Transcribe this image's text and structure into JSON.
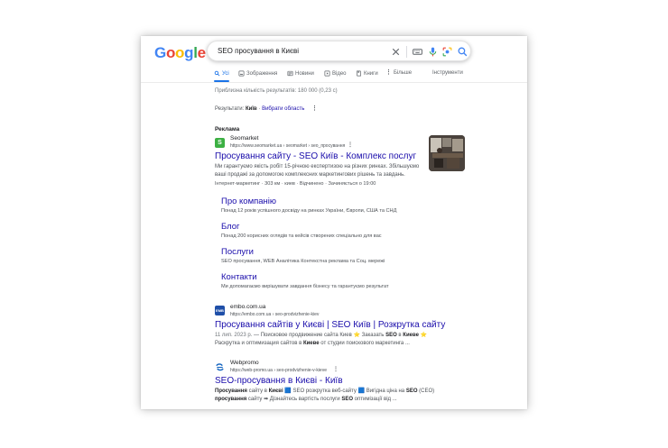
{
  "search": {
    "query": "SEO просування в Києві"
  },
  "tabs": [
    {
      "label": "Усі",
      "icon": "search-icon",
      "active": true
    },
    {
      "label": "Зображення",
      "icon": "image-icon"
    },
    {
      "label": "Новини",
      "icon": "news-icon"
    },
    {
      "label": "Відео",
      "icon": "video-icon"
    },
    {
      "label": "Книги",
      "icon": "book-icon"
    },
    {
      "label": "Більше",
      "icon": "more-vert-icon"
    },
    {
      "label": "Інструменти",
      "icon": ""
    }
  ],
  "stats": "Приблизна кількість результатів: 180 000 (0,23 с)",
  "location": {
    "prefix": "Результати:",
    "city": "Київ",
    "sep": " · ",
    "choose": "Вибрати область"
  },
  "ad": {
    "label": "Реклама",
    "site": "Seomarket",
    "url": "https://www.seomarket.ua › seomarket › seo_просування",
    "title": "Просування сайту - SEO Київ - Комплекс послуг",
    "snippet1": "Ми гарантуємо якість робіт 15-річною експертизою на різних ринках. Збільшуємо",
    "snippet2": "ваші продажі за допомогою комплексних маркетингових рішень та завдань.",
    "meta": "Інтернет-маркетинг · 303 км · киев · Відчинено · Зачиняється о 19:00",
    "sitelinks": [
      {
        "title": "Про компанію",
        "desc": "Понад 12 років успішного досвіду на ринках України, Європи, США та СНД"
      },
      {
        "title": "Блог",
        "desc": "Понад 200 корисних оглядів та кейсів створених спеціально для вас"
      },
      {
        "title": "Послуги",
        "desc": "SEO просування, WEB Аналітика Контекстна реклама та Соц. мережі"
      },
      {
        "title": "Контакти",
        "desc": "Ми допомагаємо вирішувати завдання бізнесу та гарантуємо результат"
      }
    ]
  },
  "result1": {
    "site": "embo.com.ua",
    "url": "https://embo.com.ua › seo-prodvizhenie-kiev",
    "title": "Просування сайтів у Києві | SEO Київ | Розкрутка сайту",
    "date": "11 лип. 2023 р.",
    "dash": " — Поисковое продвижение сайта Киев ⭐ Заказать ",
    "bold1": "SEO",
    "mid1": " в ",
    "bold2": "Киеве",
    "end1": " ⭐",
    "line2a": "Раскрутка и оптимизация сайтов в ",
    "line2b": "Киеве",
    "line2c": " от студии поискового маркетинга ..."
  },
  "result2": {
    "site": "Webpromo",
    "url": "https://web-promo.ua › seo-prodvizhenie-v-kieve",
    "title": "SEO-просування в Києві - Київ",
    "l1a": "Просування",
    "l1b": " сайту в ",
    "l1c": "Києві",
    "l1d": " 🟦 SEO розкрутка веб-сайту 🟦 Вигідна ціна на ",
    "l1e": "SEO",
    "l1f": " (СЕО)",
    "l2a": "просування",
    "l2b": " сайту ➡ Дізнайтесь вартість послуги ",
    "l2c": "SEO",
    "l2d": " оптимізації від ..."
  }
}
